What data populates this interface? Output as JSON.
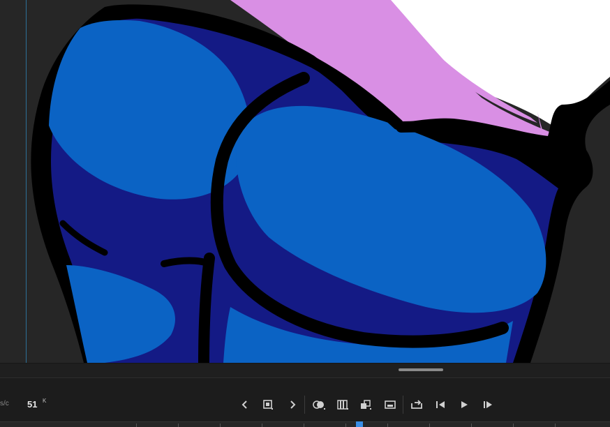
{
  "stage": {
    "artwork_colors": {
      "outline": "#000000",
      "denim_dark": "#141a85",
      "denim_light": "#0b63c4",
      "shirt_pink": "#d98fe4",
      "shirt_white": "#ffffff",
      "background": "#262626",
      "guide": "#2f7fae"
    }
  },
  "toolbar": {
    "fps_label": "s/c",
    "current_frame": "51",
    "frame_suffix": "K",
    "buttons": [
      {
        "name": "previous-keyframe",
        "icon": "chevron-left-icon"
      },
      {
        "name": "insert-keyframe",
        "icon": "keyframe-box-icon"
      },
      {
        "name": "next-keyframe",
        "icon": "chevron-right-icon"
      },
      {
        "name": "onion-skin",
        "icon": "onion-skin-icon"
      },
      {
        "name": "edit-multiple-frames",
        "icon": "multi-frames-icon"
      },
      {
        "name": "center-frame",
        "icon": "center-frame-icon"
      },
      {
        "name": "loop-range",
        "icon": "loop-range-icon"
      },
      {
        "name": "loop-playback",
        "icon": "loop-icon"
      },
      {
        "name": "step-back",
        "icon": "step-back-icon"
      },
      {
        "name": "play",
        "icon": "play-icon"
      },
      {
        "name": "step-forward",
        "icon": "step-forward-icon"
      }
    ],
    "accent": "#3a8ee6"
  }
}
